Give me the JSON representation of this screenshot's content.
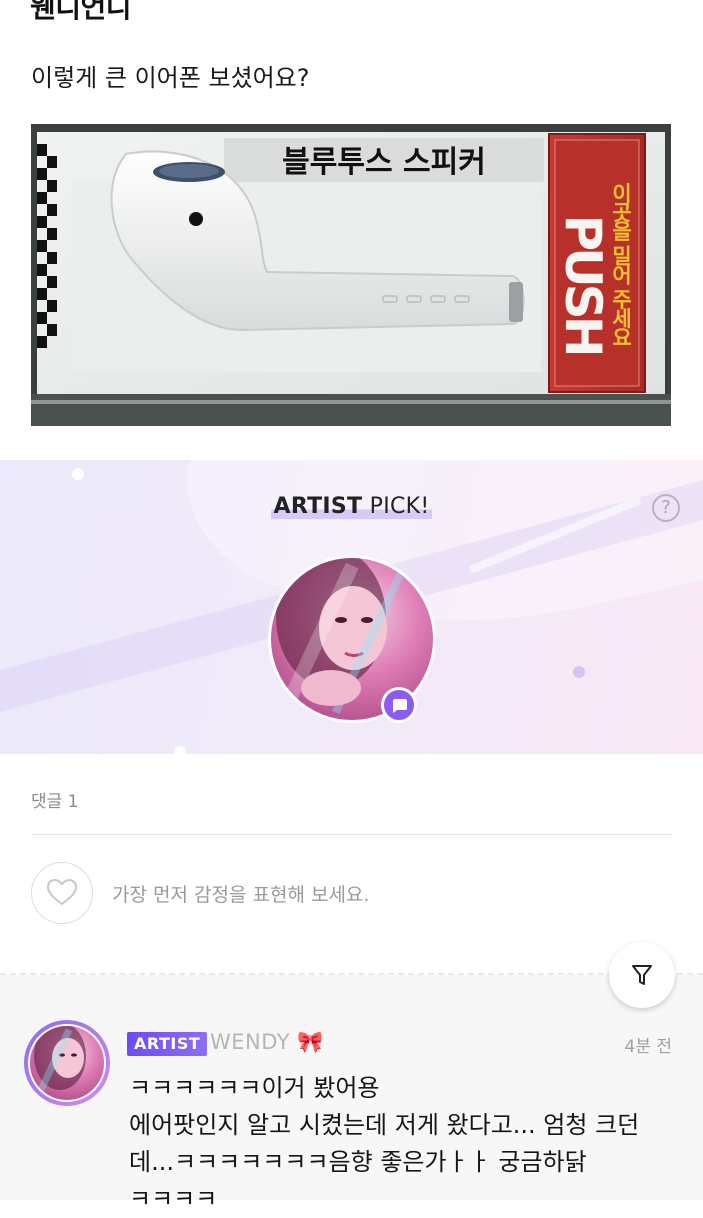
{
  "post": {
    "header_title": "웬디언니",
    "body_text": "이렇게 큰 이어폰 보셨어요?",
    "image": {
      "sign_text": "블루투스 스피커",
      "push_text": "PUSH",
      "push_sub_text": "이곳을 밀어 주세요"
    }
  },
  "artist_pick": {
    "title_bold": "ARTIST",
    "title_rest": " PICK!",
    "help_icon_label": "?",
    "accent_color": "#8c5cf0"
  },
  "comments_section": {
    "count_label": "댓글 1",
    "reaction_prompt": "가장 먼저 감정을 표현해 보세요.",
    "filter_icon": "filter-funnel-icon"
  },
  "comments": [
    {
      "badge": "ARTIST",
      "author": "WENDY 🎀",
      "time": "4분 전",
      "text": "ㅋㅋㅋㅋㅋㅋ이거 봤어용\n에어팟인지 알고 시켰는데 저게 왔다고... 엄청 크던데...ㅋㅋㅋㅋㅋㅋㅋ음향 좋은가ㅏㅏ 궁금하닭\nㅋㅋㅋㅋ"
    }
  ]
}
